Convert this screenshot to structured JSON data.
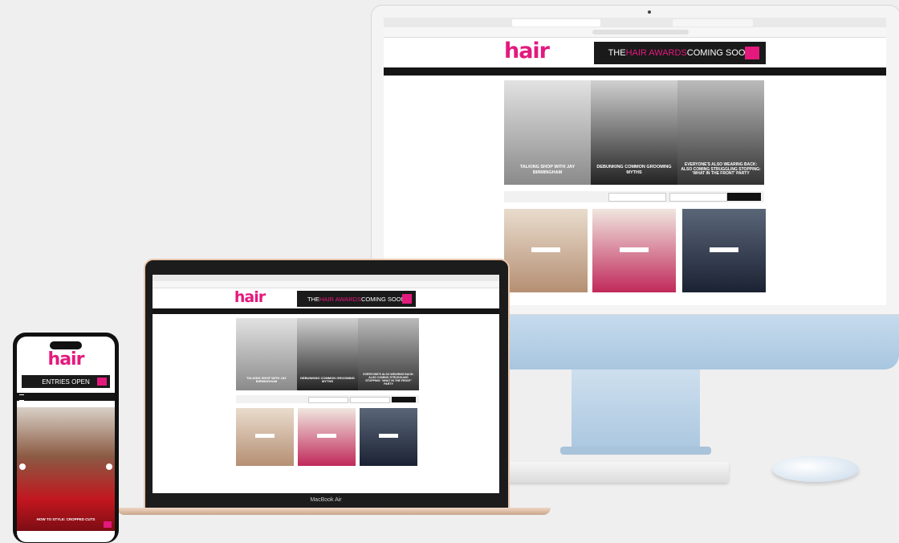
{
  "brand": {
    "logo": "hair"
  },
  "banner": {
    "prefix": "THE ",
    "highlight": "HAIR AWARDS",
    "suffix": " COMING SOON"
  },
  "phone": {
    "banner": "ENTRIES OPEN",
    "caption": "HOW TO STYLE: CROPPED CUTS"
  },
  "features": [
    {
      "caption": "TALKING SHOP WITH JAY BIRMINGHAM"
    },
    {
      "caption": "DEBUNKING COMMON GROOMING MYTHS"
    },
    {
      "caption": "EVERYONE'S ALSO WEARING BACK: ALSO COMING STRUGGLING STOPPING: 'WHAT IN THE FRONT' PARTY"
    }
  ],
  "laptop": {
    "model": "MacBook Air"
  },
  "colors": {
    "brand_pink": "#e4197d",
    "imac_blue": "#b7d0e6",
    "laptop_gold": "#e9c7ae"
  }
}
